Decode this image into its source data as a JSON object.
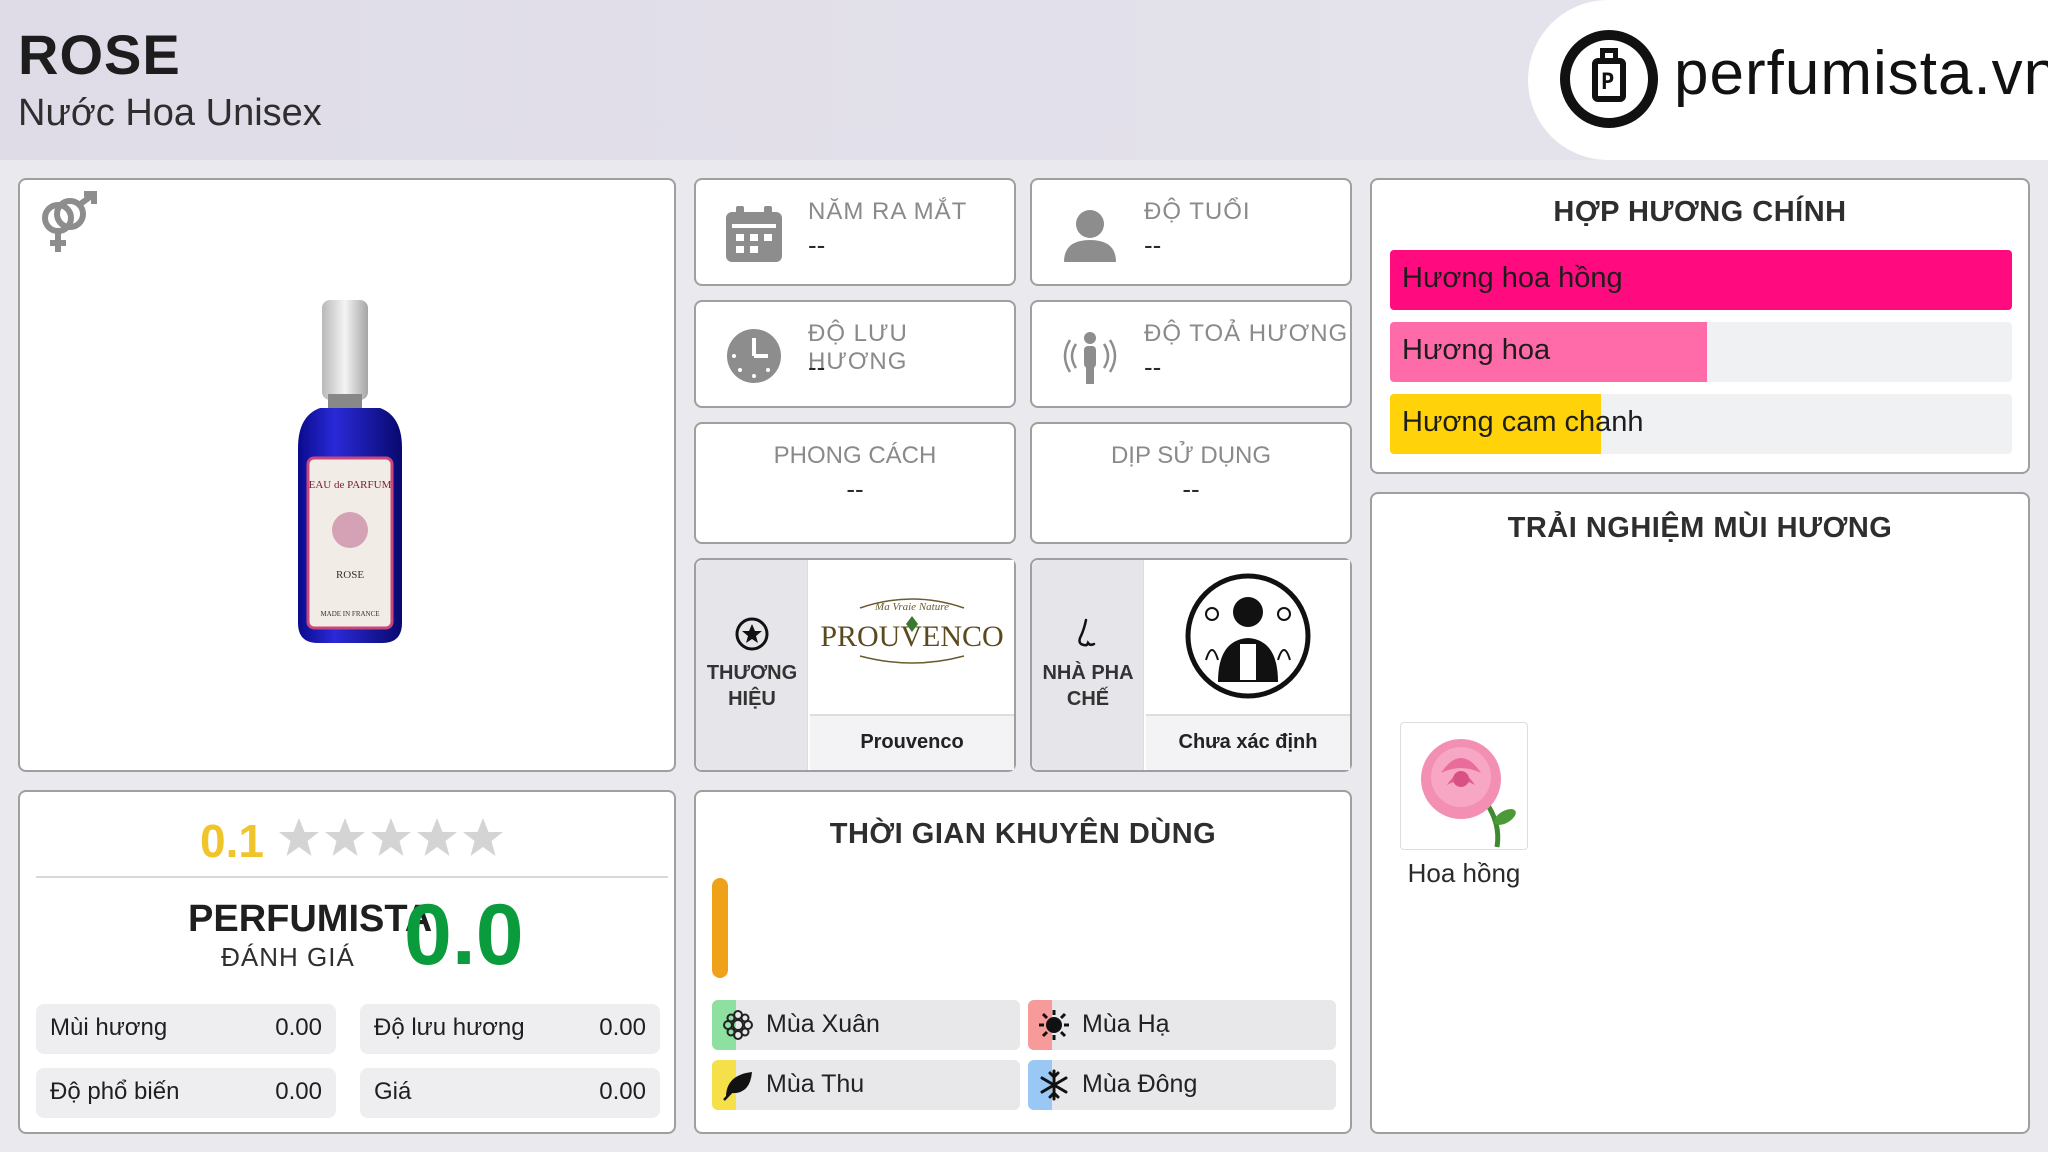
{
  "header": {
    "title": "ROSE",
    "subtitle": "Nước Hoa Unisex",
    "logo_text": "perfumista.vn"
  },
  "info_cards": {
    "launch_year": {
      "label": "NĂM RA MẮT",
      "value": "--",
      "icon": "calendar-icon"
    },
    "age": {
      "label": "ĐỘ TUỔI",
      "value": "--",
      "icon": "person-icon"
    },
    "longevity": {
      "label": "ĐỘ LƯU HƯƠNG",
      "value": "--",
      "icon": "clock-icon"
    },
    "sillage": {
      "label": "ĐỘ TOẢ HƯƠNG",
      "value": "--",
      "icon": "sillage-icon"
    },
    "style": {
      "label": "PHONG CÁCH",
      "value": "--"
    },
    "occasion": {
      "label": "DỊP SỬ DỤNG",
      "value": "--"
    }
  },
  "brand": {
    "side_label_1": "THƯƠNG",
    "side_label_2": "HIỆU",
    "name": "Prouvenco",
    "logo_text": "PROUVENCO",
    "logo_sub": "Ma Vraie Nature"
  },
  "perfumer": {
    "side_label_1": "NHÀ PHA",
    "side_label_2": "CHẾ",
    "name": "Chưa xác định"
  },
  "accords": {
    "title": "HỢP HƯƠNG CHÍNH",
    "items": [
      {
        "label": "Hương hoa hồng",
        "value": 1.0,
        "color": "#ff0a7f"
      },
      {
        "label": "Hương hoa",
        "value": 0.51,
        "color": "#ff6aa8"
      },
      {
        "label": "Hương cam chanh",
        "value": 0.34,
        "color": "#ffd20a"
      }
    ]
  },
  "experience": {
    "title": "TRẢI NGHIỆM MÙI HƯƠNG",
    "notes": [
      {
        "label": "Hoa hồng",
        "icon": "rose-icon"
      }
    ]
  },
  "rating": {
    "user_score": "0.1",
    "stars_filled": 0,
    "stars_total": 5,
    "perfumista_label": "PERFUMISTA",
    "perfumista_sub": "ĐÁNH GIÁ",
    "perfumista_score": "0.0",
    "scores": [
      {
        "label": "Mùi hương",
        "value": "0.00"
      },
      {
        "label": "Độ lưu hương",
        "value": "0.00"
      },
      {
        "label": "Độ phổ biến",
        "value": "0.00"
      },
      {
        "label": "Giá",
        "value": "0.00"
      }
    ]
  },
  "season": {
    "title": "THỜI GIAN KHUYÊN DÙNG",
    "bar_color": "#f0a11a",
    "items": [
      {
        "label": "Mùa Xuân",
        "color": "#8ee0a0",
        "icon": "flower-icon"
      },
      {
        "label": "Mùa Hạ",
        "color": "#f79a9a",
        "icon": "sun-icon"
      },
      {
        "label": "Mùa Thu",
        "color": "#f5e04a",
        "icon": "leaf-icon"
      },
      {
        "label": "Mùa Đông",
        "color": "#9ac8f5",
        "icon": "snowflake-icon"
      }
    ]
  },
  "product_image": {
    "label_line1": "EAU de PARFUM",
    "label_line2": "ROSE",
    "label_line3": "MADE IN FRANCE"
  }
}
